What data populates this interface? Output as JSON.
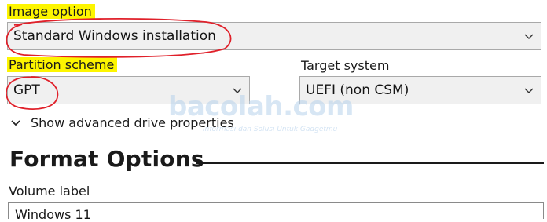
{
  "image_option": {
    "label": "Image option",
    "value": "Standard Windows installation"
  },
  "partition_scheme": {
    "label": "Partition scheme",
    "value": "GPT"
  },
  "target_system": {
    "label": "Target system",
    "value": "UEFI (non CSM)"
  },
  "advanced": {
    "label": "Show advanced drive properties"
  },
  "format_options": {
    "title": "Format Options"
  },
  "volume_label": {
    "label": "Volume label",
    "value": "Windows 11"
  },
  "watermark": {
    "logo": "bacolah.com",
    "tagline": "Informasi dan Solusi Untuk Gadgetmu"
  },
  "colors": {
    "highlight": "#fdf500",
    "annotation_circle": "#e0202a",
    "combo_background": "#f0f0f0"
  },
  "icons": [
    "chevron-down-icon",
    "chevron-down-icon",
    "chevron-down-icon",
    "expand-chevron-icon"
  ]
}
